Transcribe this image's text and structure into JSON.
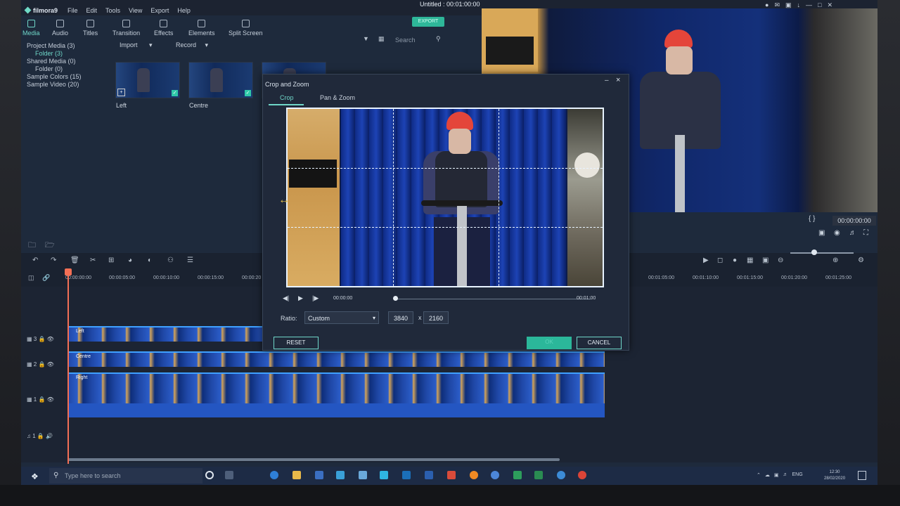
{
  "app": {
    "logo": "filmora9",
    "window_title": "Untitled : 00:01:00:00",
    "menu": [
      "File",
      "Edit",
      "Tools",
      "View",
      "Export",
      "Help"
    ],
    "export_label": "EXPORT"
  },
  "toolbar": {
    "tools": [
      "Media",
      "Audio",
      "Titles",
      "Transition",
      "Effects",
      "Elements",
      "Split Screen"
    ],
    "import_label": "Import",
    "record_label": "Record"
  },
  "search": {
    "placeholder": "Search"
  },
  "sidebar": {
    "items": [
      "Project Media (3)",
      "Folder (3)",
      "Shared Media (0)",
      "Folder (0)",
      "Sample Colors (15)",
      "Sample Video (20)"
    ]
  },
  "media": {
    "clips": [
      "Left",
      "Centre"
    ]
  },
  "preview": {
    "timecode": "00:00:00:00"
  },
  "timeline": {
    "ruler_left": [
      "00:00:00:00",
      "00:00:05:00",
      "00:00:10:00",
      "00:00:15:00",
      "00:00:20"
    ],
    "ruler_right": [
      "00:01:05:00",
      "00:01:10:00",
      "00:01:15:00",
      "00:01:20:00",
      "00:01:25:00"
    ],
    "tracks": [
      {
        "head": "3",
        "clip": "Left"
      },
      {
        "head": "2",
        "clip": "Centre"
      },
      {
        "head": "1",
        "clip": "Right"
      }
    ],
    "audio_head": "1"
  },
  "dialog": {
    "title": "Crop and Zoom",
    "tabs": [
      "Crop",
      "Pan & Zoom"
    ],
    "time_start": "00:00:00",
    "time_end": "00:01:00",
    "ratio_label": "Ratio:",
    "ratio_value": "Custom",
    "width": "3840",
    "height": "2160",
    "x_sep": "x",
    "reset_label": "RESET",
    "ok_label": "OK",
    "cancel_label": "CANCEL"
  },
  "taskbar": {
    "search_placeholder": "Type here to search",
    "lang": "ENG",
    "time": "12:30",
    "date": "28/02/2020"
  }
}
